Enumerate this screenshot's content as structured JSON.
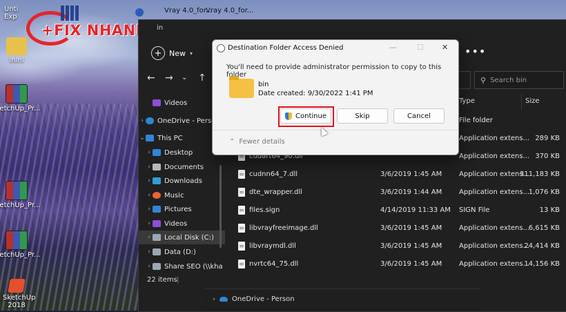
{
  "desktop": {
    "logo": "+FIX NHANH",
    "top_shortcuts": [
      "Vray 4.0_for...",
      "Vray 4.0_for..."
    ],
    "icons": [
      {
        "label": "Unti\nExp",
        "kind": "folder"
      },
      {
        "label": "lnlnl",
        "kind": "folder"
      },
      {
        "label": "ketchUp_Pr...",
        "kind": "rar"
      },
      {
        "label": "ketchUp_Pr...",
        "kind": "rar"
      },
      {
        "label": "ketchUp_Pr...",
        "kind": "rar"
      },
      {
        "label": "SketchUp 2018",
        "kind": "sketchup"
      }
    ]
  },
  "explorer": {
    "title_fragment": "in",
    "new_label": "New",
    "search_placeholder": "Search bin",
    "status_items": "22 items",
    "sidebar": [
      {
        "label": "Videos",
        "color": "#8b4fd6"
      },
      {
        "label": "OneDrive - Person",
        "color": "#2f86d6"
      },
      {
        "label": "This PC",
        "color": "#2f86d6"
      },
      {
        "label": "Desktop",
        "color": "#2f86d6"
      },
      {
        "label": "Documents",
        "color": "#b8b8b8"
      },
      {
        "label": "Downloads",
        "color": "#2fa0d6"
      },
      {
        "label": "Music",
        "color": "#e5653a"
      },
      {
        "label": "Pictures",
        "color": "#2f86d6"
      },
      {
        "label": "Videos",
        "color": "#8b4fd6"
      },
      {
        "label": "Local Disk (C:)",
        "color": "#9aa7b5"
      },
      {
        "label": "Data (D:)",
        "color": "#9aa7b5"
      },
      {
        "label": "Share SEO (\\\\kha",
        "color": "#9aa7b5"
      }
    ],
    "columns": {
      "type": "Type",
      "size": "Size"
    },
    "rows": [
      {
        "name": "",
        "date": "",
        "type": "File folder",
        "size": ""
      },
      {
        "name": "",
        "date": "",
        "type": "Application extens...",
        "size": "289 KB"
      },
      {
        "name": "cudart64_90.dll",
        "date": "",
        "type": "Application extens...",
        "size": "370 KB"
      },
      {
        "name": "cudnn64_7.dll",
        "date": "3/6/2019 1:45 AM",
        "type": "Application extens...",
        "size": "311,183 KB"
      },
      {
        "name": "dte_wrapper.dll",
        "date": "3/6/2019 1:44 AM",
        "type": "Application extens...",
        "size": "1,076 KB"
      },
      {
        "name": "files.sign",
        "date": "4/14/2019 11:33 AM",
        "type": "SIGN File",
        "size": "13 KB"
      },
      {
        "name": "libvrayfreeimage.dll",
        "date": "3/6/2019 1:45 AM",
        "type": "Application extens...",
        "size": "6,615 KB"
      },
      {
        "name": "libvraymdl.dll",
        "date": "3/6/2019 1:45 AM",
        "type": "Application extens...",
        "size": "24,414 KB"
      },
      {
        "name": "nvrtc64_75.dll",
        "date": "3/6/2019 1:45 AM",
        "type": "Application extens...",
        "size": "14,156 KB"
      }
    ],
    "bottom_panel": "OneDrive - Person"
  },
  "dialog": {
    "title": "Destination Folder Access Denied",
    "message": "You'll need to provide administrator permission to copy to this folder",
    "folder_name": "bin",
    "folder_date": "Date created: 9/30/2022 1:41 PM",
    "buttons": {
      "continue": "Continue",
      "skip": "Skip",
      "cancel": "Cancel"
    },
    "fewer_details": "Fewer details",
    "colors": {
      "highlight": "#e3121e",
      "accent": "#2f78d3"
    }
  }
}
